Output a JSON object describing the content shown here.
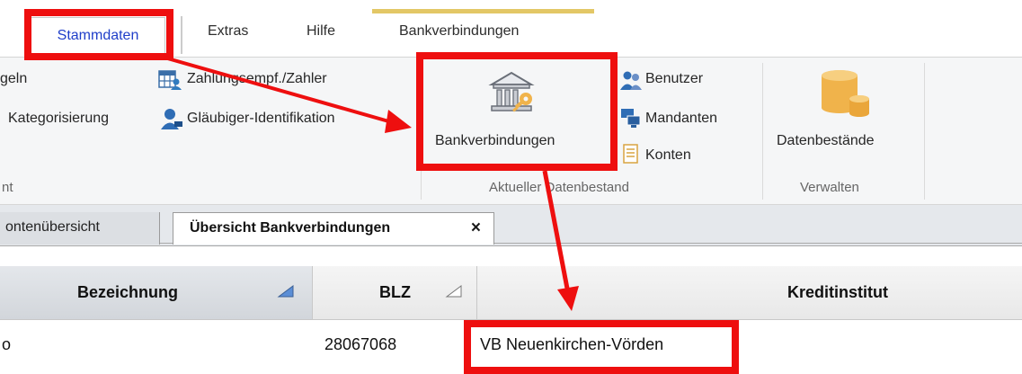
{
  "ribbon_tabs": {
    "stammdaten": "Stammdaten",
    "extras": "Extras",
    "hilfe": "Hilfe",
    "bankverbindungen": "Bankverbindungen"
  },
  "ribbon": {
    "regeln_partial": "geln",
    "kategorisierung": "Kategorisierung",
    "group1_label_partial": "nt",
    "zahlungsempf": "Zahlungsempf./Zahler",
    "glaeubiger": "Gläubiger-Identifikation",
    "bankverbindungen_button": "Bankverbindungen",
    "benutzer": "Benutzer",
    "mandanten": "Mandanten",
    "konten": "Konten",
    "group2_label": "Aktueller Datenbestand",
    "datenbestaende": "Datenbestände",
    "group3_label": "Verwalten"
  },
  "doc_tabs": {
    "inactive": "ontenübersicht",
    "active": "Übersicht Bankverbindungen",
    "close": "×"
  },
  "table": {
    "headers": {
      "bezeichnung": "Bezeichnung",
      "blz": "BLZ",
      "kreditinstitut": "Kreditinstitut"
    },
    "row": {
      "bezeichnung_partial": "o",
      "blz": "28067068",
      "kreditinstitut": "VB Neuenkirchen-Vörden"
    }
  },
  "colors": {
    "annotation_red": "#ee0f0f",
    "active_tab_text": "#1f3ec9",
    "contextual_tab_bar": "#e3c766",
    "database_icon": "#f0b34b"
  },
  "icons": [
    "table-user-icon",
    "user-id-icon",
    "bank-key-icon",
    "users-icon",
    "monitors-icon",
    "ledger-icon",
    "database-icon",
    "sort-icon"
  ]
}
